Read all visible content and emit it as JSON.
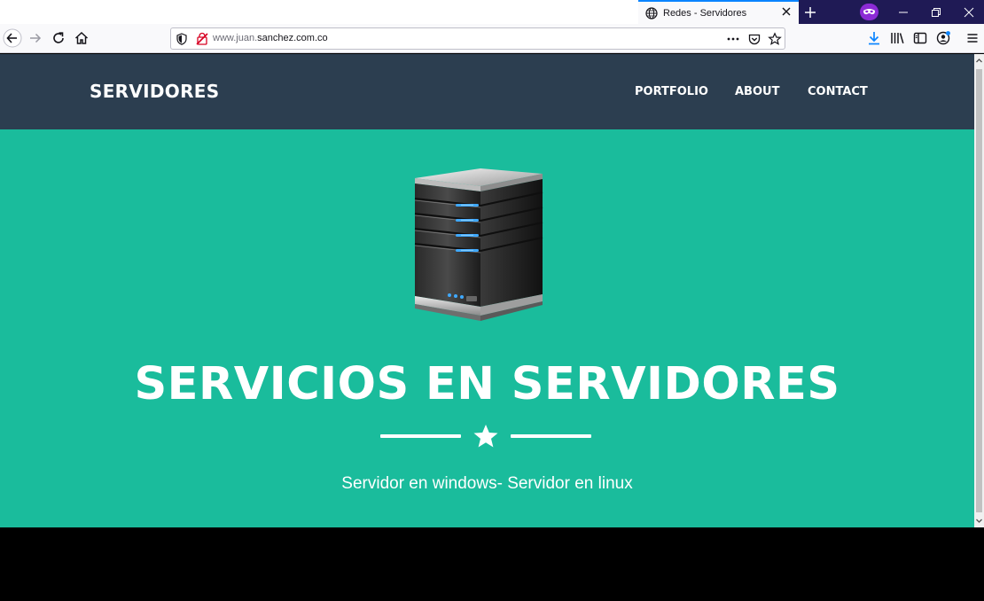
{
  "browser": {
    "tab": {
      "title": "Redes - Servidores"
    },
    "url": {
      "prefix": "www.juan.",
      "domain": "sanchez.com.co"
    }
  },
  "site": {
    "brand": "SERVIDORES",
    "nav": [
      {
        "label": "PORTFOLIO"
      },
      {
        "label": "ABOUT"
      },
      {
        "label": "CONTACT"
      }
    ],
    "headline": "SERVICIOS EN SERVIDORES",
    "subtitle": "Servidor en windows- Servidor en linux"
  },
  "colors": {
    "nav_bg": "#2c3e50",
    "masthead_bg": "#1abc9c",
    "tab_accent": "#0a84ff",
    "private_badge": "#8c2bd6"
  },
  "icons": [
    "globe-icon",
    "close-icon",
    "plus-icon",
    "private-browsing-icon",
    "back-icon",
    "forward-icon",
    "reload-icon",
    "home-icon",
    "shield-icon",
    "tracking-off-icon",
    "more-icon",
    "pocket-icon",
    "bookmark-star-icon",
    "download-icon",
    "library-icon",
    "sidebar-icon",
    "account-icon",
    "menu-icon",
    "server-image",
    "star-icon"
  ]
}
